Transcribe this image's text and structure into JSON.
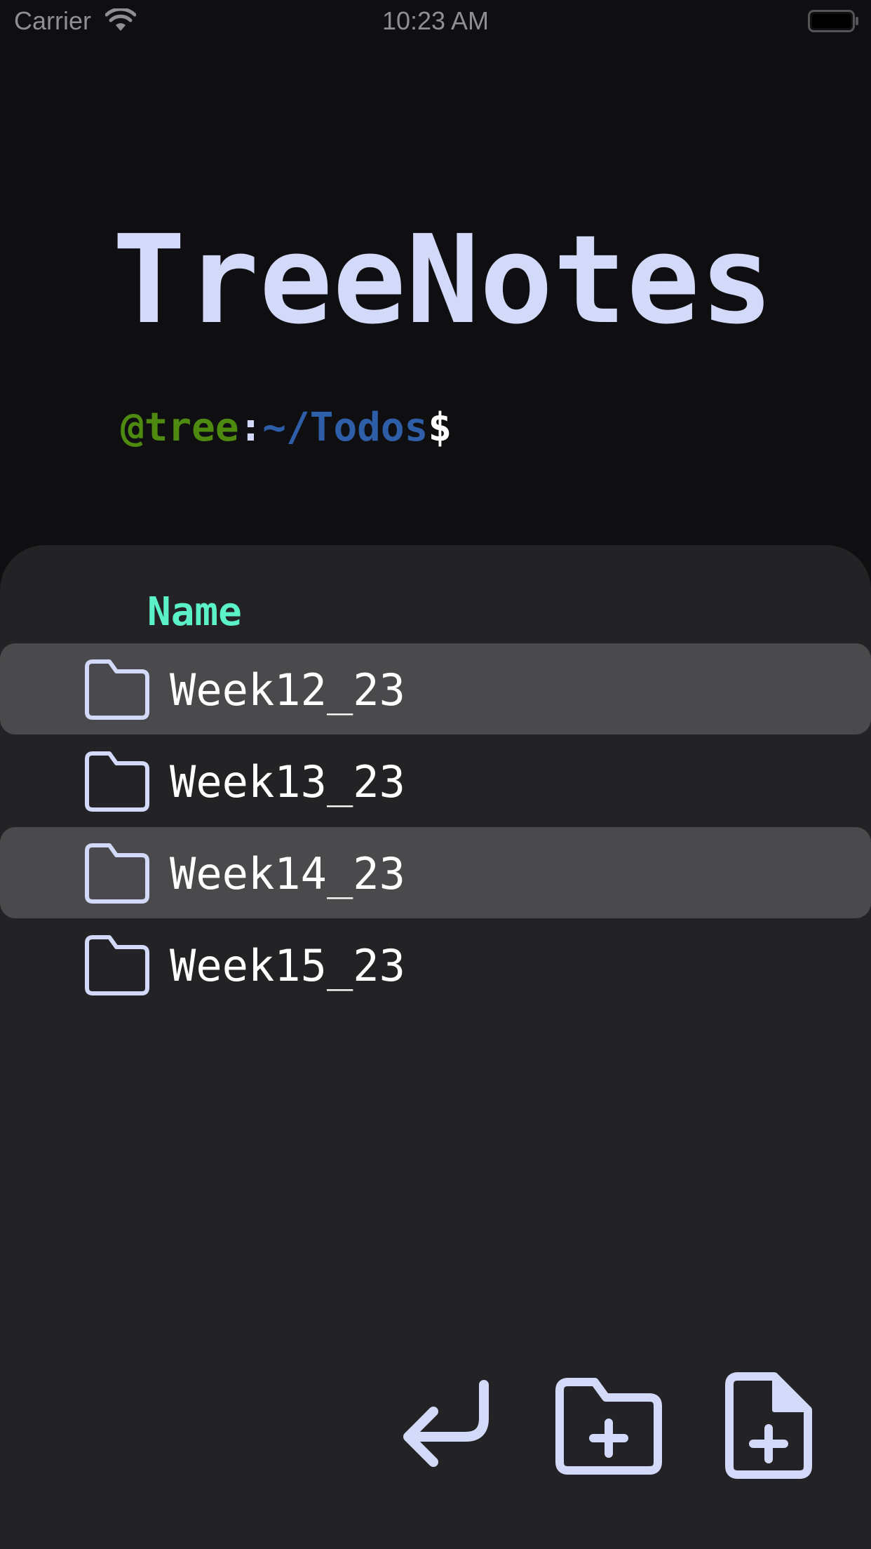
{
  "status_bar": {
    "carrier": "Carrier",
    "time": "10:23 AM"
  },
  "app": {
    "title": "TreeNotes"
  },
  "prompt": {
    "user": "@tree",
    "separator": ":",
    "path": "~/Todos",
    "dollar": "$"
  },
  "list": {
    "header": "Name",
    "items": [
      {
        "name": "Week12_23",
        "icon": "folder-icon"
      },
      {
        "name": "Week13_23",
        "icon": "folder-icon"
      },
      {
        "name": "Week14_23",
        "icon": "folder-icon"
      },
      {
        "name": "Week15_23",
        "icon": "folder-icon"
      }
    ]
  },
  "actions": {
    "back_icon": "return-arrow-icon",
    "new_folder_icon": "folder-plus-icon",
    "new_file_icon": "file-plus-icon"
  },
  "colors": {
    "background": "#0f0f11",
    "panel": "#232325",
    "row_highlight": "#4a4a4c",
    "title": "#d2d9f9",
    "header": "#5cf2c8",
    "prompt_user": "#4f8a10",
    "prompt_path": "#2f5ea8"
  }
}
